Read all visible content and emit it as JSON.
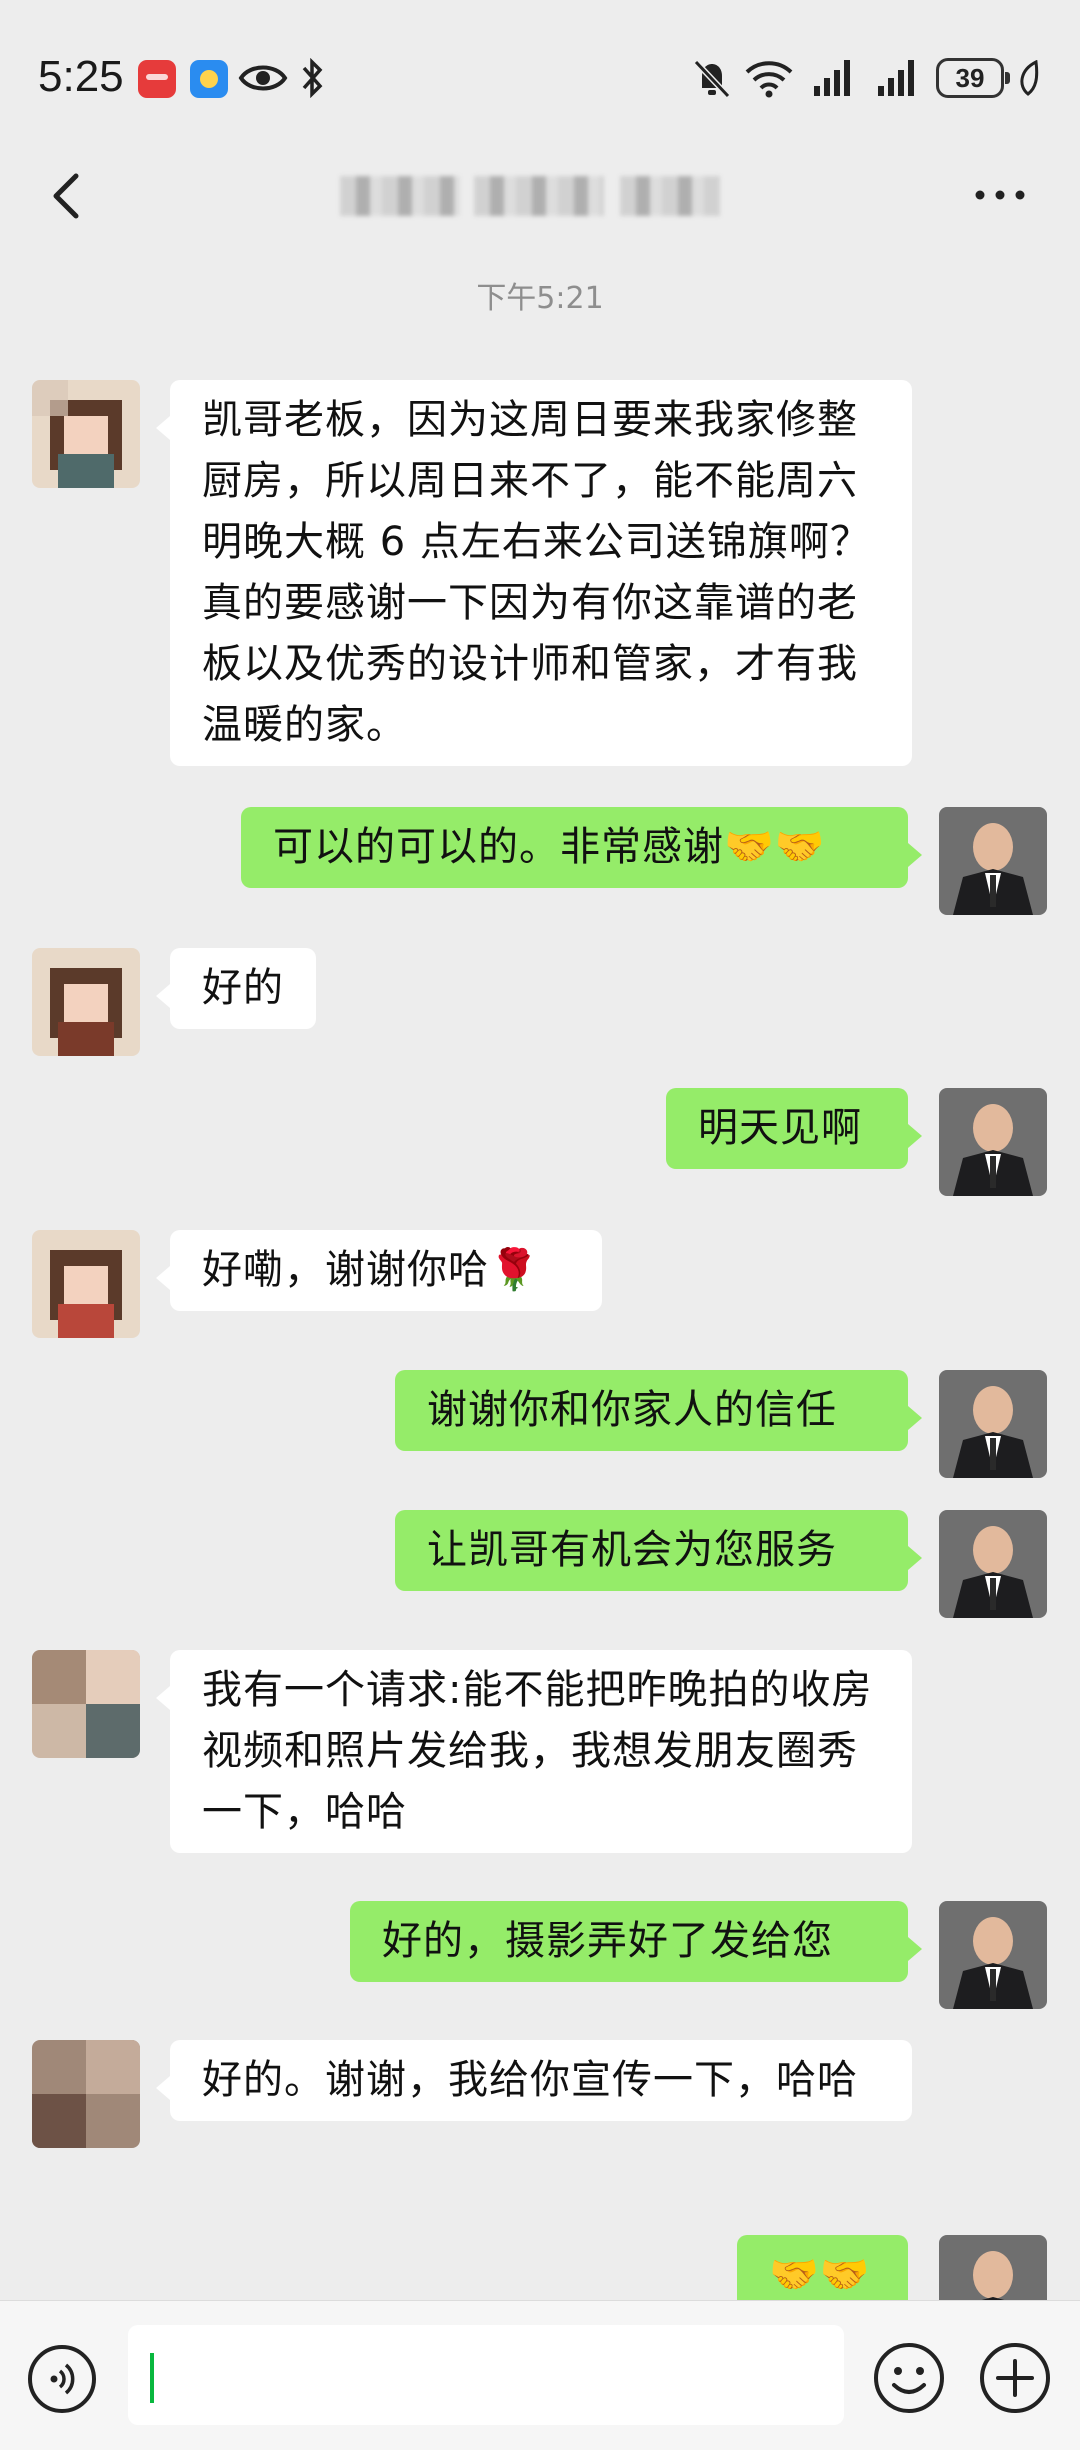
{
  "status_bar": {
    "time": "5:25",
    "battery": "39",
    "icons": [
      "app-store-icon",
      "weather-icon",
      "eye-icon",
      "bluetooth-icon",
      "mute-icon",
      "wifi-icon",
      "signal-icon",
      "signal-icon",
      "battery-icon",
      "leaf-icon"
    ]
  },
  "header": {
    "back_icon": "chevron-left-icon",
    "more_icon": "more-dots-icon"
  },
  "timestamp": "下午5:21",
  "messages": [
    {
      "side": "left",
      "text": "凯哥老板，因为这周日要来我家修整厨房，所以周日来不了，能不能周六明晚大概 6 点左右来公司送锦旗啊？真的要感谢一下因为有你这靠谱的老板以及优秀的设计师和管家，才有我温暖的家。"
    },
    {
      "side": "right",
      "text": "可以的可以的。非常感谢🤝🤝"
    },
    {
      "side": "left",
      "text": "好的"
    },
    {
      "side": "right",
      "text": "明天见啊"
    },
    {
      "side": "left",
      "text": "好嘞，谢谢你哈🌹"
    },
    {
      "side": "right",
      "text": "谢谢你和你家人的信任"
    },
    {
      "side": "right",
      "text": "让凯哥有机会为您服务"
    },
    {
      "side": "left",
      "text": "我有一个请求:能不能把昨晚拍的收房视频和照片发给我，我想发朋友圈秀一下，哈哈"
    },
    {
      "side": "right",
      "text": "好的，摄影弄好了发给您"
    },
    {
      "side": "left",
      "text": "好的。谢谢，我给你宣传一下，哈哈"
    },
    {
      "side": "right",
      "text": "🤝🤝"
    }
  ],
  "input_bar": {
    "voice_icon": "voice-icon",
    "emoji_icon": "smiley-icon",
    "plus_icon": "plus-icon",
    "value": ""
  },
  "colors": {
    "background": "#ededed",
    "self_bubble": "#95ec69",
    "other_bubble": "#ffffff",
    "caret": "#09b83e"
  }
}
